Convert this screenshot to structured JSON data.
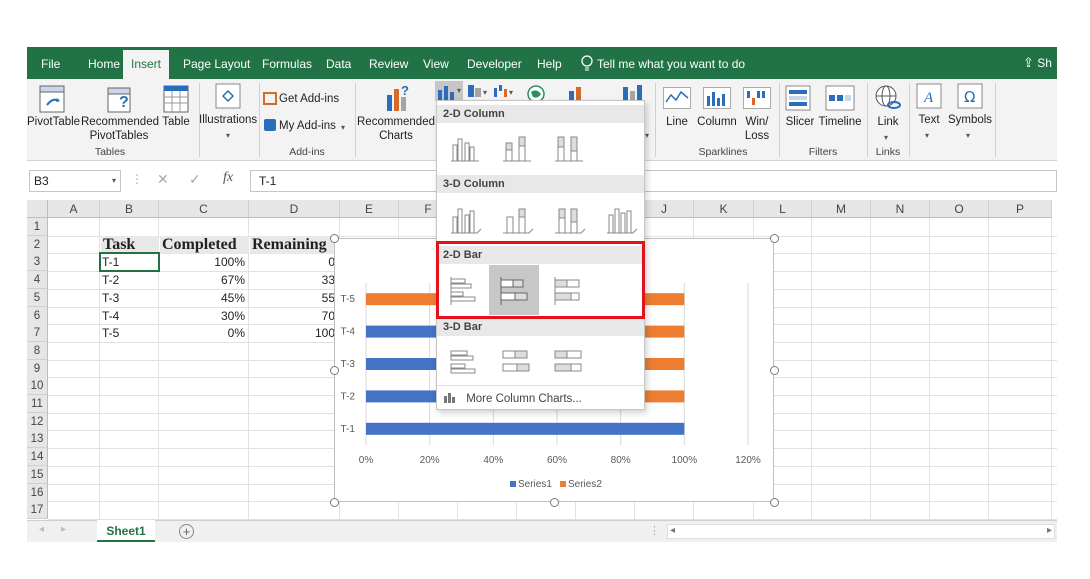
{
  "ribbon_tabs": [
    "File",
    "Home",
    "Insert",
    "Page Layout",
    "Formulas",
    "Data",
    "Review",
    "View",
    "Developer",
    "Help"
  ],
  "active_tab": "Insert",
  "tell_me": "Tell me what you want to do",
  "share_label": "Sh",
  "ribbon": {
    "pivottable": "PivotTable",
    "recommended_pivot_1": "Recommended",
    "recommended_pivot_2": "PivotTables",
    "table": "Table",
    "illustrations": "Illustrations",
    "get_addins": "Get Add-ins",
    "my_addins": "My Add-ins",
    "recommended_charts_1": "Recommended",
    "recommended_charts_2": "Charts",
    "line": "Line",
    "column": "Column",
    "winloss_1": "Win/",
    "winloss_2": "Loss",
    "slicer": "Slicer",
    "timeline": "Timeline",
    "link": "Link",
    "text": "Text",
    "symbols": "Symbols",
    "group_tables": "Tables",
    "group_addins": "Add-ins",
    "group_sparklines": "Sparklines",
    "group_filters": "Filters",
    "group_links": "Links"
  },
  "namebox": "B3",
  "formula": "T-1",
  "columns": [
    "A",
    "B",
    "C",
    "D",
    "E",
    "F",
    "G",
    "H",
    "I",
    "J",
    "K",
    "L",
    "M",
    "N",
    "O",
    "P"
  ],
  "rows": [
    "1",
    "2",
    "3",
    "4",
    "5",
    "6",
    "7",
    "8",
    "9",
    "10",
    "11",
    "12",
    "13",
    "14",
    "15",
    "16",
    "17"
  ],
  "table": {
    "headers": [
      "Task",
      "Completed",
      "Remaining"
    ],
    "rows": [
      [
        "T-1",
        "100%",
        "0"
      ],
      [
        "T-2",
        "67%",
        "33"
      ],
      [
        "T-3",
        "45%",
        "55"
      ],
      [
        "T-4",
        "30%",
        "70"
      ],
      [
        "T-5",
        "0%",
        "100"
      ]
    ]
  },
  "dropdown": {
    "sec_2d_column": "2-D Column",
    "sec_3d_column": "3-D Column",
    "sec_2d_bar": "2-D Bar",
    "sec_3d_bar": "3-D Bar",
    "more": "More Column Charts..."
  },
  "sheet_tab": "Sheet1",
  "colors": {
    "excel_green": "#217346",
    "series1": "#4472c4",
    "series2": "#ed7d31",
    "highlight": "#e3131a"
  },
  "chart_data": {
    "type": "bar",
    "orientation": "horizontal",
    "stacked": true,
    "categories": [
      "T-1",
      "T-2",
      "T-3",
      "T-4",
      "T-5"
    ],
    "series": [
      {
        "name": "Series1",
        "values": [
          1.0,
          0.67,
          0.45,
          0.3,
          0.0
        ]
      },
      {
        "name": "Series2",
        "values": [
          0.0,
          0.33,
          0.55,
          0.7,
          1.0
        ]
      }
    ],
    "xlim": [
      0,
      1.2
    ],
    "xticks": [
      "0%",
      "20%",
      "40%",
      "60%",
      "80%",
      "100%",
      "120%"
    ],
    "grid": true,
    "legend": "bottom"
  }
}
